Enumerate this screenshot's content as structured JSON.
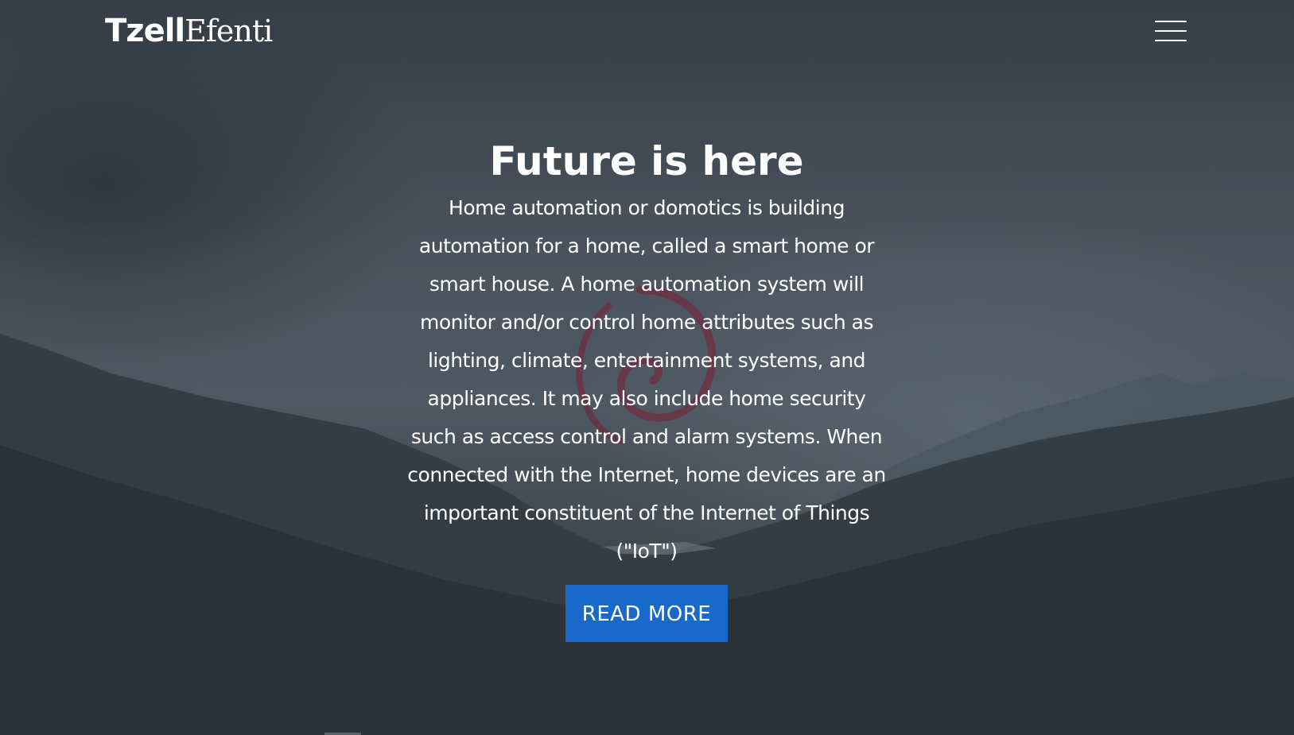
{
  "header": {
    "logo_bold": "Tzell",
    "logo_light": "Efenti",
    "menu_icon": "hamburger-menu-icon"
  },
  "hero": {
    "title": "Future is here",
    "description": "Home automation or domotics is building automation for a home, called a smart home or smart house. A home automation system will monitor and/or control home attributes such as lighting, climate, entertainment systems, and appliances. It may also include home security such as access control and alarm systems. When connected with the Internet, home devices are an important constituent of the Internet of Things (\"IoT\")",
    "button_label": "READ MORE"
  },
  "colors": {
    "button_bg": "#1869c9",
    "text": "#ffffff",
    "overlay_dark": "#2c333b",
    "debian_swirl": "#7a1f35"
  },
  "background": {
    "scene": "misty-mountains-image",
    "watermark_icon": "debian-swirl-icon"
  }
}
